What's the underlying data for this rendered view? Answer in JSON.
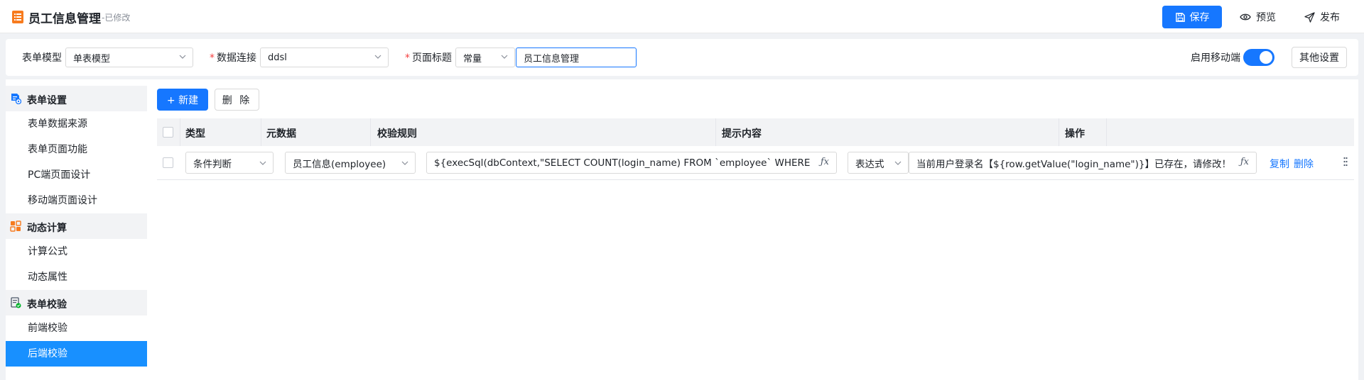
{
  "header": {
    "title": "员工信息管理",
    "status": "-已修改",
    "save_label": "保存",
    "preview_label": "预览",
    "publish_label": "发布"
  },
  "form": {
    "model_label": "表单模型",
    "model_value": "单表模型",
    "connection_label": "数据连接",
    "connection_value": "ddsl",
    "title_label": "页面标题",
    "title_type": "常量",
    "title_value": "员工信息管理",
    "mobile_label": "启用移动端",
    "mobile_enabled": true,
    "other_settings_label": "其他设置"
  },
  "sidebar": {
    "groups": [
      {
        "label": "表单设置",
        "icon": "form-settings-icon",
        "items": [
          "表单数据来源",
          "表单页面功能",
          "PC端页面设计",
          "移动端页面设计"
        ]
      },
      {
        "label": "动态计算",
        "icon": "dynamic-calc-icon",
        "items": [
          "计算公式",
          "动态属性"
        ]
      },
      {
        "label": "表单校验",
        "icon": "form-validate-icon",
        "items": [
          "前端校验",
          "后端校验"
        ]
      }
    ],
    "active_item": "后端校验"
  },
  "toolbar": {
    "new_label": "+ 新建",
    "delete_label": "删 除"
  },
  "table": {
    "columns": [
      "类型",
      "元数据",
      "校验规则",
      "提示内容",
      "操作"
    ],
    "rows": [
      {
        "type": "条件判断",
        "metadata": "员工信息(employee)",
        "rule": "${execSql(dbContext,\"SELECT COUNT(login_name) FROM `employee` WHERE login_na",
        "hint_type": "表达式",
        "hint": "当前用户登录名【${row.getValue(\"login_name\")}】已存在，请修改！",
        "action_copy": "复制",
        "action_delete": "删除"
      }
    ]
  },
  "colors": {
    "primary": "#1677ff",
    "sidebar_active": "#1890ff",
    "required": "#f53f3f",
    "accent_orange": "#f77b1e"
  }
}
